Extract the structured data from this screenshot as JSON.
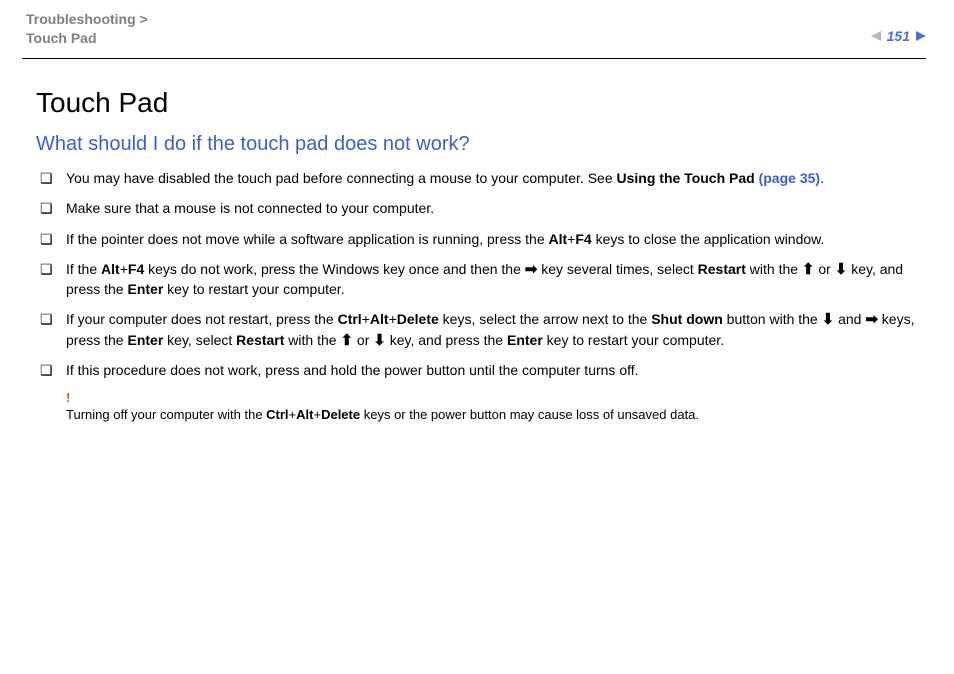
{
  "header": {
    "breadcrumb_section": "Troubleshooting",
    "breadcrumb_sep": " >",
    "breadcrumb_page": "Touch Pad",
    "page_number": "151"
  },
  "main": {
    "title": "Touch Pad",
    "subtitle": "What should I do if the touch pad does not work?",
    "items": [
      {
        "pre": "You may have disabled the touch pad before connecting a mouse to your computer. See ",
        "bold": "Using the Touch Pad ",
        "link": "(page 35)",
        "post": "."
      },
      {
        "text": "Make sure that a mouse is not connected to your computer."
      },
      {
        "p1": "If the pointer does not move while a software application is running, press the ",
        "b1": "Alt",
        "plus1": "+",
        "b2": "F4",
        "p2": " keys to close the application window."
      },
      {
        "p1": "If the ",
        "b1": "Alt",
        "plus1": "+",
        "b2": "F4",
        "p2": " keys do not work, press the Windows key once and then the ",
        "arrow1": "➡",
        "p3": " key several times, select ",
        "b3": "Restart",
        "p4": " with the ",
        "arrow2": "⬆",
        "or": " or ",
        "arrow3": "⬇",
        "p5": " key, and press the ",
        "b4": "Enter",
        "p6": " key to restart your computer."
      },
      {
        "p1": "If your computer does not restart, press the ",
        "b1": "Ctrl",
        "plus1": "+",
        "b2": "Alt",
        "plus2": "+",
        "b3": "Delete",
        "p2": " keys, select the arrow next to the ",
        "b4": "Shut down",
        "p3": " button with the ",
        "arrow1": "⬇",
        "and": " and ",
        "arrow2": "➡",
        "p4": " keys, press the ",
        "b5": "Enter",
        "p5": " key, select ",
        "b6": "Restart",
        "p6": " with the ",
        "arrow3": "⬆",
        "or": " or ",
        "arrow4": "⬇",
        "p7": " key, and press the ",
        "b7": "Enter",
        "p8": " key to restart your computer."
      },
      {
        "text": "If this procedure does not work, press and hold the power button until the computer turns off."
      }
    ],
    "note": {
      "bang": "!",
      "p1": "Turning off your computer with the ",
      "b1": "Ctrl",
      "plus1": "+",
      "b2": "Alt",
      "plus2": "+",
      "b3": "Delete",
      "p2": " keys or the power button may cause loss of unsaved data."
    }
  }
}
